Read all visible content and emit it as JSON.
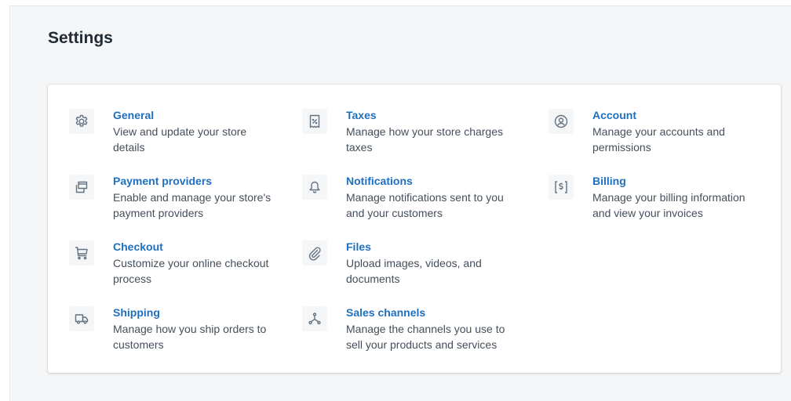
{
  "page_title": "Settings",
  "items": [
    {
      "label": "General",
      "desc": "View and update your store details",
      "icon": "gear-icon"
    },
    {
      "label": "Payment providers",
      "desc": "Enable and manage your store's payment providers",
      "icon": "payment-card-icon"
    },
    {
      "label": "Checkout",
      "desc": "Customize your online checkout process",
      "icon": "cart-icon"
    },
    {
      "label": "Shipping",
      "desc": "Manage how you ship orders to customers",
      "icon": "truck-icon"
    },
    {
      "label": "Taxes",
      "desc": "Manage how your store charges taxes",
      "icon": "tax-receipt-icon"
    },
    {
      "label": "Notifications",
      "desc": "Manage notifications sent to you and your customers",
      "icon": "bell-icon"
    },
    {
      "label": "Files",
      "desc": "Upload images, videos, and documents",
      "icon": "paperclip-icon"
    },
    {
      "label": "Sales channels",
      "desc": "Manage the channels you use to sell your products and services",
      "icon": "sales-channels-icon"
    },
    {
      "label": "Account",
      "desc": "Manage your accounts and permissions",
      "icon": "user-circle-icon"
    },
    {
      "label": "Billing",
      "desc": "Manage your billing information and view your invoices",
      "icon": "billing-icon"
    }
  ],
  "colors": {
    "link": "#1f6fc0",
    "icon": "#637381",
    "background": "#f4f6f8"
  }
}
